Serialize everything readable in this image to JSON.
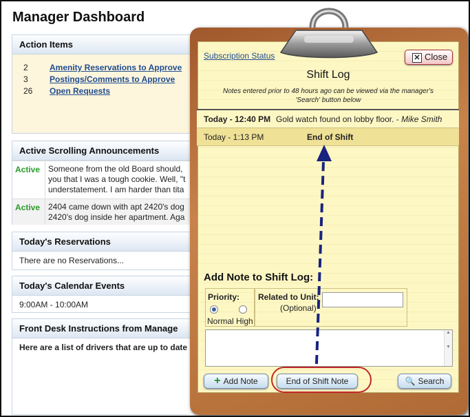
{
  "dashboard": {
    "title": "Manager Dashboard",
    "action_items": {
      "heading": "Action Items",
      "rows": [
        {
          "count": "2",
          "label": "Amenity Reservations to Approve"
        },
        {
          "count": "3",
          "label": "Postings/Comments to Approve"
        },
        {
          "count": "26",
          "label": "Open Requests"
        }
      ]
    },
    "announcements": {
      "heading": "Active Scrolling Announcements",
      "rows": [
        {
          "status": "Active",
          "lines": [
            "Someone from the old Board should,",
            "you that I was a tough cookie. Well, \"t",
            "understatement. I am harder than tita"
          ]
        },
        {
          "status": "Active",
          "lines": [
            "2404 came down with apt 2420's dog",
            "2420's dog inside her apartment. Aga"
          ]
        }
      ]
    },
    "reservations": {
      "heading": "Today's Reservations",
      "body": "There are no Reservations..."
    },
    "calendar": {
      "heading": "Today's Calendar Events",
      "body": "9:00AM - 10:00AM"
    },
    "front_desk": {
      "heading": "Front Desk Instructions from Manage",
      "body": "Here are a list of drivers that are up to date i"
    }
  },
  "shift_log": {
    "subscription_link": "Subscription Status",
    "close_label": "Close",
    "close_icon": "close-x-icon",
    "title": "Shift Log",
    "note_lines": [
      "Notes entered prior to 48 hours ago can be viewed via the manager's",
      "'Search' button below"
    ],
    "entries": [
      {
        "time": "Today - 12:40 PM",
        "message": "Gold watch found on lobby floor. - ",
        "author": "Mike Smith"
      },
      {
        "time": "Today - 1:13 PM",
        "message": "End of Shift",
        "author": ""
      }
    ],
    "add_note": {
      "title": "Add Note to Shift Log:",
      "priority_label": "Priority:",
      "priority_options": [
        "Normal",
        "High"
      ],
      "priority_selected": "Normal",
      "related_label": "Related to Unit:",
      "related_optional": "(Optional)",
      "unit_value": "",
      "note_value": ""
    },
    "buttons": {
      "add_note": "Add Note",
      "end_of_shift": "End of Shift Note",
      "search": "Search"
    },
    "colors": {
      "highlight_ring": "#c0262a",
      "arrow": "#1a237e",
      "paper": "#fdf7c4",
      "board": "#b06a35"
    }
  }
}
